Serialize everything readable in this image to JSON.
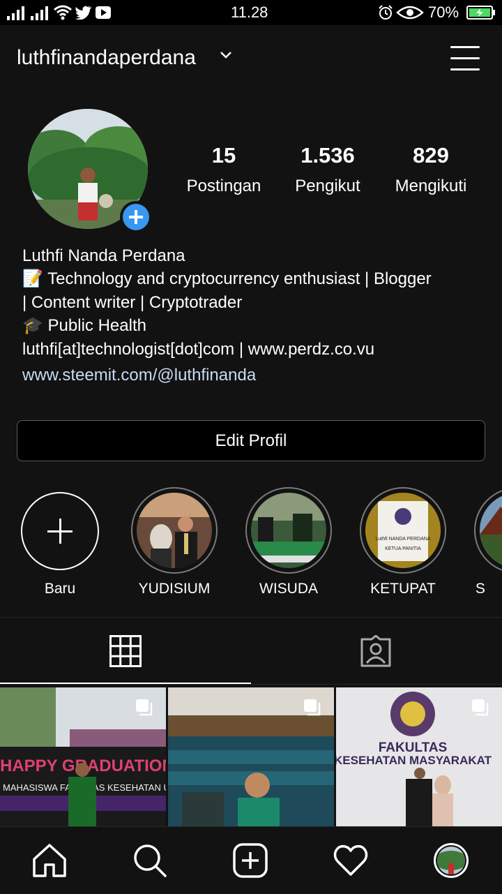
{
  "status_bar": {
    "time": "11.28",
    "battery": "70%",
    "icons": [
      "signal-icon",
      "signal-icon",
      "wifi-icon",
      "twitter-icon",
      "youtube-icon",
      "alarm-icon",
      "eye-icon",
      "battery-charging-icon"
    ]
  },
  "header": {
    "username": "luthfinandaperdana",
    "icons": [
      "chevron-down-icon",
      "menu-icon"
    ]
  },
  "stats": [
    {
      "value": "15",
      "label": "Postingan"
    },
    {
      "value": "1.536",
      "label": "Pengikut"
    },
    {
      "value": "829",
      "label": "Mengikuti"
    }
  ],
  "bio": {
    "name": "Luthfi Nanda Perdana",
    "line1": "📝 Technology and cryptocurrency enthusiast | Blogger",
    "line2": "| Content writer | Cryptotrader",
    "line3": "🎓 Public Health",
    "line4": "luthfi[at]technologist[dot]com | www.perdz.co.vu",
    "link": "www.steemit.com/@luthfinanda"
  },
  "edit_button": "Edit Profil",
  "highlights": [
    {
      "label": "Baru"
    },
    {
      "label": "YUDISIUM"
    },
    {
      "label": "WISUDA"
    },
    {
      "label": "KETUPAT"
    },
    {
      "label": "IS"
    }
  ],
  "photos": [
    {
      "text": "HAPPY GRADUATION",
      "subtext": "MAHASISWA FAKULTAS KESEHATAN UNIMUHA"
    },
    {
      "text": ""
    },
    {
      "text": "FAKULTAS",
      "subtext": "KESEHATAN MASYARAKAT"
    }
  ],
  "highlight_texts": {
    "ketupat_caption": "Luthfi NANDA PERDANA",
    "ketupat_role": "KETUA PANITIA"
  },
  "bottom_nav": [
    "home-icon",
    "search-icon",
    "add-post-icon",
    "heart-icon",
    "profile-avatar"
  ],
  "colors": {
    "background": "#121212",
    "accent": "#3897f0",
    "link": "#c7dcf1",
    "battery": "#4cd964"
  }
}
